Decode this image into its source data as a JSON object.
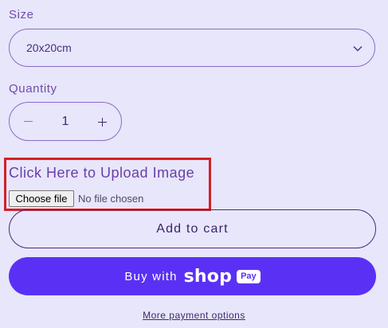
{
  "size": {
    "label": "Size",
    "selected": "20x20cm"
  },
  "quantity": {
    "label": "Quantity",
    "value": "1",
    "minus": "−",
    "plus": "+"
  },
  "upload": {
    "title": "Click Here to Upload Image",
    "button_label": "Choose file",
    "status": "No file chosen"
  },
  "actions": {
    "add_to_cart": "Add to cart",
    "buy_with": "Buy with",
    "shop_brand": "shop",
    "pay_badge": "Pay",
    "more_options": "More payment options"
  },
  "colors": {
    "background": "#e7e6fb",
    "shop_pay": "#5a31f4",
    "highlight_border": "#d32026"
  }
}
